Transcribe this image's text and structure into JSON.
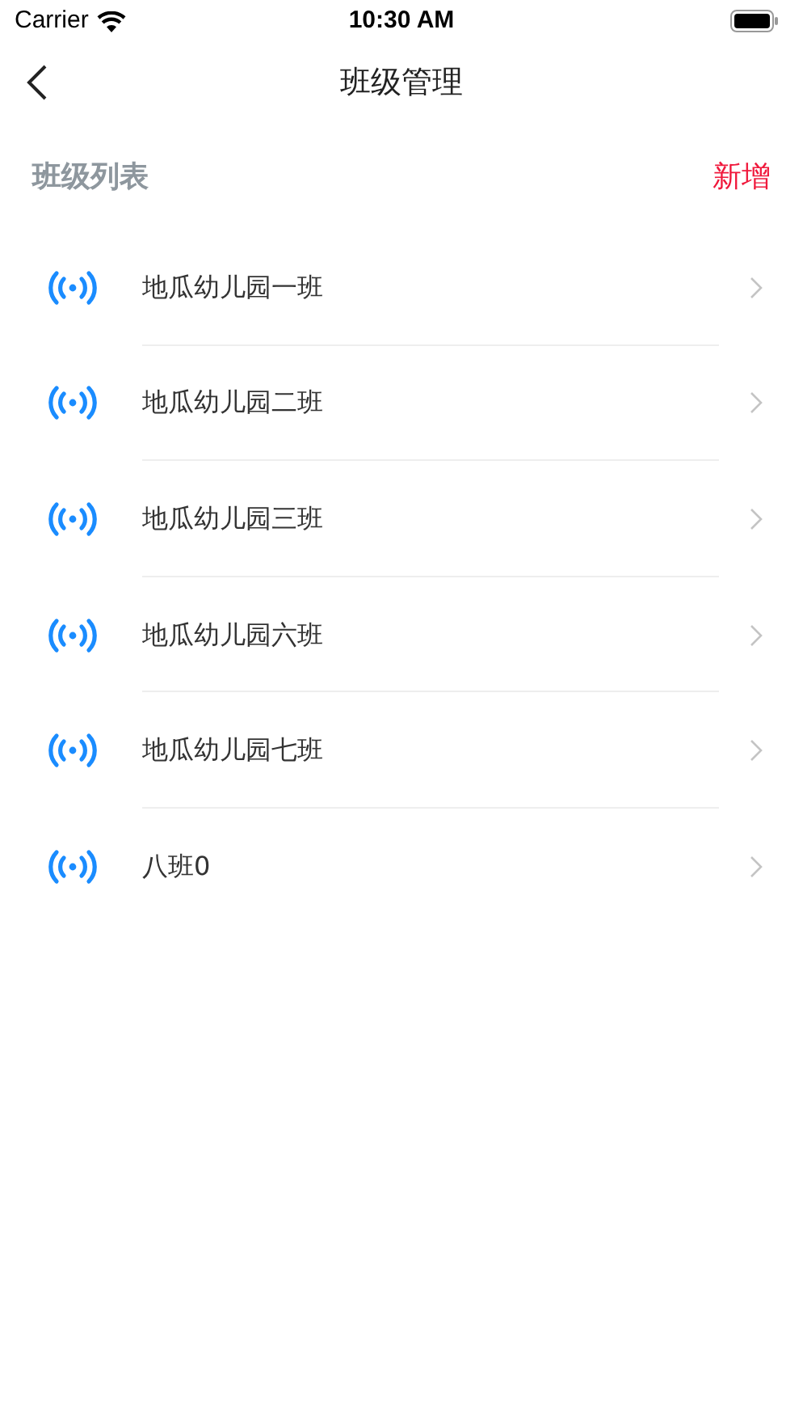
{
  "status_bar": {
    "carrier": "Carrier",
    "time": "10:30 AM"
  },
  "nav": {
    "title": "班级管理"
  },
  "section": {
    "title": "班级列表",
    "action": "新增"
  },
  "classes": [
    {
      "name": "地瓜幼儿园一班"
    },
    {
      "name": "地瓜幼儿园二班"
    },
    {
      "name": "地瓜幼儿园三班"
    },
    {
      "name": "地瓜幼儿园六班"
    },
    {
      "name": "地瓜幼儿园七班"
    },
    {
      "name": "八班0"
    }
  ]
}
